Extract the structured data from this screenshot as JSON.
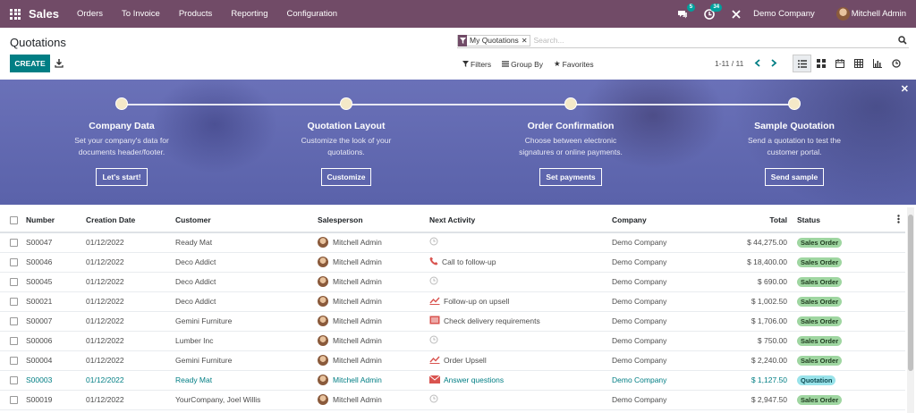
{
  "navbar": {
    "brand": "Sales",
    "menu": [
      "Orders",
      "To Invoice",
      "Products",
      "Reporting",
      "Configuration"
    ],
    "chat_count": "5",
    "activity_count": "34",
    "company": "Demo Company",
    "user": "Mitchell Admin"
  },
  "control": {
    "title": "Quotations",
    "facet": "My Quotations",
    "search_placeholder": "Search...",
    "create_label": "CREATE",
    "filters_label": "Filters",
    "groupby_label": "Group By",
    "favorites_label": "Favorites",
    "pager": "1-11 / 11"
  },
  "banner": {
    "steps": [
      {
        "title": "Company Data",
        "desc1": "Set your company's data for",
        "desc2": "documents header/footer.",
        "button": "Let's start!"
      },
      {
        "title": "Quotation Layout",
        "desc1": "Customize the look of your",
        "desc2": "quotations.",
        "button": "Customize"
      },
      {
        "title": "Order Confirmation",
        "desc1": "Choose between electronic",
        "desc2": "signatures or online payments.",
        "button": "Set payments"
      },
      {
        "title": "Sample Quotation",
        "desc1": "Send a quotation to test the",
        "desc2": "customer portal.",
        "button": "Send sample"
      }
    ]
  },
  "table": {
    "headers": [
      "Number",
      "Creation Date",
      "Customer",
      "Salesperson",
      "Next Activity",
      "Company",
      "Total",
      "Status"
    ],
    "rows": [
      {
        "number": "S00047",
        "date": "01/12/2022",
        "customer": "Ready Mat",
        "salesperson": "Mitchell Admin",
        "activity": "",
        "activity_icon": "clock-icon",
        "company": "Demo Company",
        "total": "$ 44,275.00",
        "status": "Sales Order"
      },
      {
        "number": "S00046",
        "date": "01/12/2022",
        "customer": "Deco Addict",
        "salesperson": "Mitchell Admin",
        "activity": "Call to follow-up",
        "activity_icon": "phone-icon",
        "company": "Demo Company",
        "total": "$ 18,400.00",
        "status": "Sales Order"
      },
      {
        "number": "S00045",
        "date": "01/12/2022",
        "customer": "Deco Addict",
        "salesperson": "Mitchell Admin",
        "activity": "",
        "activity_icon": "clock-icon",
        "company": "Demo Company",
        "total": "$ 690.00",
        "status": "Sales Order"
      },
      {
        "number": "S00021",
        "date": "01/12/2022",
        "customer": "Deco Addict",
        "salesperson": "Mitchell Admin",
        "activity": "Follow-up on upsell",
        "activity_icon": "trend-icon",
        "company": "Demo Company",
        "total": "$ 1,002.50",
        "status": "Sales Order"
      },
      {
        "number": "S00007",
        "date": "01/12/2022",
        "customer": "Gemini Furniture",
        "salesperson": "Mitchell Admin",
        "activity": "Check delivery requirements",
        "activity_icon": "list-icon",
        "company": "Demo Company",
        "total": "$ 1,706.00",
        "status": "Sales Order"
      },
      {
        "number": "S00006",
        "date": "01/12/2022",
        "customer": "Lumber Inc",
        "salesperson": "Mitchell Admin",
        "activity": "",
        "activity_icon": "clock-icon",
        "company": "Demo Company",
        "total": "$ 750.00",
        "status": "Sales Order"
      },
      {
        "number": "S00004",
        "date": "01/12/2022",
        "customer": "Gemini Furniture",
        "salesperson": "Mitchell Admin",
        "activity": "Order Upsell",
        "activity_icon": "trend-icon",
        "company": "Demo Company",
        "total": "$ 2,240.00",
        "status": "Sales Order"
      },
      {
        "number": "S00003",
        "date": "01/12/2022",
        "customer": "Ready Mat",
        "salesperson": "Mitchell Admin",
        "activity": "Answer questions",
        "activity_icon": "envelope-icon",
        "company": "Demo Company",
        "total": "$ 1,127.50",
        "status": "Quotation"
      },
      {
        "number": "S00019",
        "date": "01/12/2022",
        "customer": "YourCompany, Joel Willis",
        "salesperson": "Mitchell Admin",
        "activity": "",
        "activity_icon": "clock-icon",
        "company": "Demo Company",
        "total": "$ 2,947.50",
        "status": "Sales Order"
      }
    ]
  },
  "colors": {
    "navbar": "#714b67",
    "primary": "#017e84",
    "banner": "#5f67ae",
    "activity_red": "#d9534f"
  }
}
